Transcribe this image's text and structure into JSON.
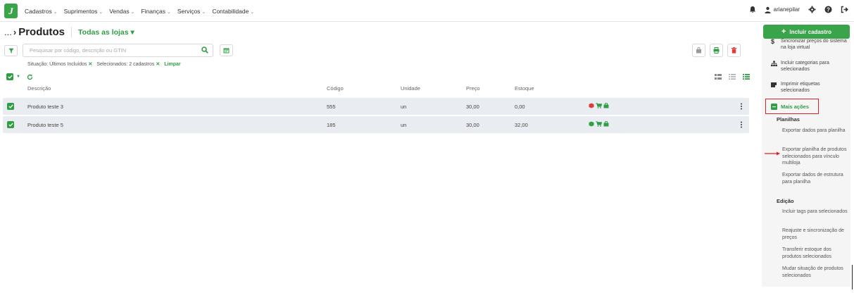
{
  "nav": {
    "logo": "J",
    "items": [
      "Cadastros",
      "Suprimentos",
      "Vendas",
      "Finanças",
      "Serviços",
      "Contabilidade"
    ],
    "username": "arianepilar"
  },
  "header": {
    "breadcrumb": "...",
    "title": "Produtos",
    "stores_label": "Todas as lojas ▾"
  },
  "search": {
    "placeholder": "Pesquisar por código, descrição ou GTIN"
  },
  "filters": {
    "situacao": "Situação: Últimos Incluídos",
    "selecionados": "Selecionados: 2 cadastros",
    "remove": "✕",
    "clear": "Limpar"
  },
  "table": {
    "columns": [
      "Descrição",
      "Código",
      "Unidade",
      "Preço",
      "Estoque"
    ],
    "rows": [
      {
        "descricao": "Produto teste 3",
        "codigo": "555",
        "unidade": "un",
        "preco": "30,00",
        "estoque": "0,00"
      },
      {
        "descricao": "Produto teste 5",
        "codigo": "185",
        "unidade": "un",
        "preco": "30,00",
        "estoque": "32,00"
      }
    ]
  },
  "panel": {
    "include_label": "Incluir cadastro",
    "items": [
      "Sincronizar preços do sistema na loja virtual",
      "Incluir categorias para selecionados",
      "Imprimir etiquetas selecionados"
    ],
    "more_actions": "Mais ações",
    "section_planilhas": "Planilhas",
    "planilhas": [
      "Exportar dados para planilha",
      "Exportar planilha de produtos selecionados para vínculo multiloja",
      "Exportar dados de estrutura para planilha"
    ],
    "section_edicao": "Edição",
    "edicao": [
      "Incluir tags para selecionados",
      "Reajuste e sincronização de preços",
      "Transferir estoque dos produtos selecionados",
      "Mudar situação de produtos selecionados"
    ]
  },
  "colors": {
    "brand_green": "#3aa44b",
    "accent_green": "#2f9e44",
    "highlight_red": "#e02020",
    "row_bg": "#e9ecf1"
  }
}
